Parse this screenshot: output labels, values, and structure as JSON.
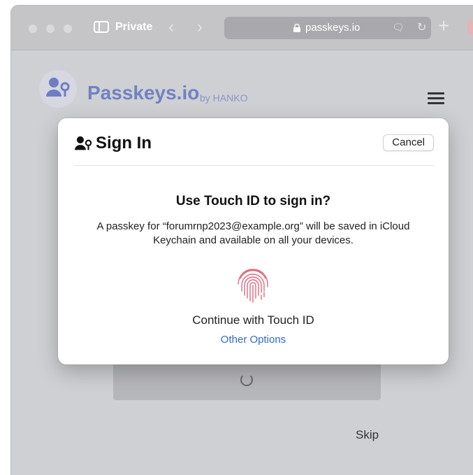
{
  "browser": {
    "mode_label": "Private",
    "address": "passkeys.io"
  },
  "site": {
    "brand": "Passkeys.io",
    "by": "by HANKO",
    "skip_label": "Skip"
  },
  "dialog": {
    "title": "Sign In",
    "cancel_label": "Cancel",
    "heading": "Use Touch ID to sign in?",
    "description": "A passkey for “forumrnp2023@example.org” will be saved in iCloud Keychain and available on all your devices.",
    "continue_label": "Continue with Touch ID",
    "other_options_label": "Other Options"
  },
  "icons": {
    "logo": "user-key-icon",
    "fingerprint": "fingerprint-icon",
    "menu": "hamburger-menu-icon"
  },
  "colors": {
    "brand": "#7181c3",
    "link": "#2f6ad0",
    "fingerprint": "#e0697f"
  }
}
